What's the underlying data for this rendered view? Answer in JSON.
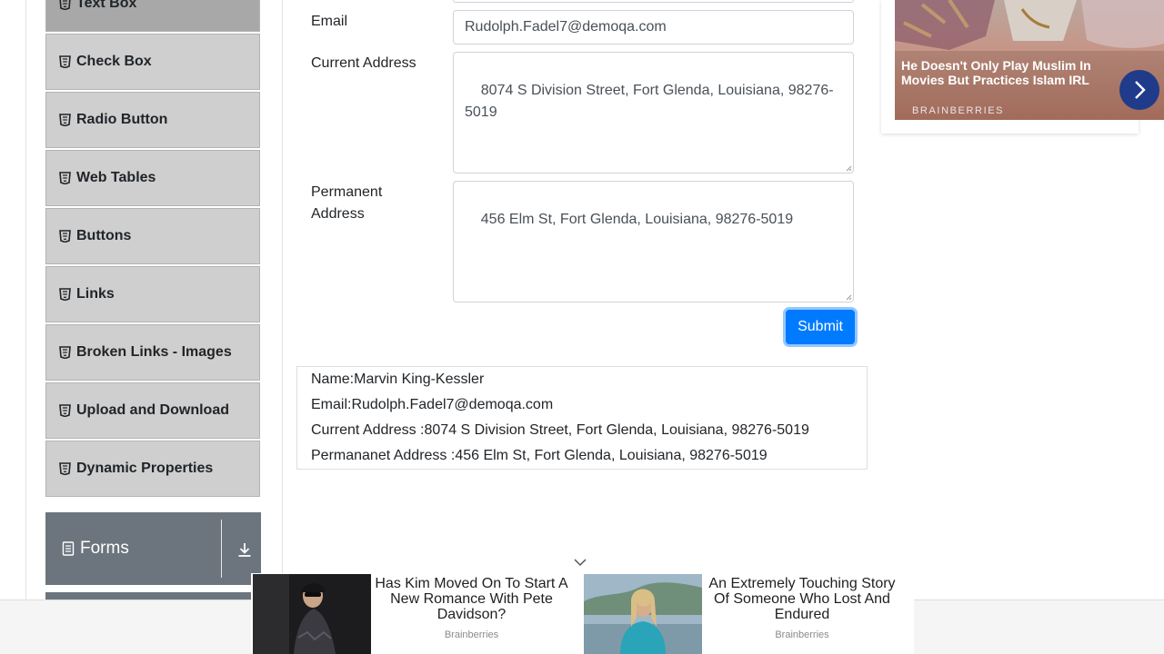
{
  "sidebar": {
    "items": [
      {
        "label": "Text Box",
        "icon": "html5-icon"
      },
      {
        "label": "Check Box",
        "icon": "html5-icon"
      },
      {
        "label": "Radio Button",
        "icon": "html5-icon"
      },
      {
        "label": "Web Tables",
        "icon": "html5-icon"
      },
      {
        "label": "Buttons",
        "icon": "html5-icon"
      },
      {
        "label": "Links",
        "icon": "html5-icon"
      },
      {
        "label": "Broken Links - Images",
        "icon": "html5-icon"
      },
      {
        "label": "Upload and Download",
        "icon": "html5-icon"
      },
      {
        "label": "Dynamic Properties",
        "icon": "html5-icon"
      }
    ],
    "group": {
      "label": "Forms",
      "icon": "document-icon",
      "toggle_icon": "download-arrow-icon"
    }
  },
  "form": {
    "email": {
      "label": "Email",
      "value": "Rudolph.Fadel7@demoqa.com"
    },
    "current_address": {
      "label": "Current Address",
      "value": "8074 S Division Street, Fort Glenda, Louisiana, 98276-5019"
    },
    "permanent_address": {
      "label": "Permanent Address",
      "value": "456 Elm St, Fort Glenda, Louisiana, 98276-5019"
    },
    "submit_label": "Submit"
  },
  "output": {
    "name": "Name:Marvin King-Kessler",
    "email": "Email:Rudolph.Fadel7@demoqa.com",
    "current_address": "Current Address :8074 S Division Street, Fort Glenda, Louisiana, 98276-5019",
    "permanent_address": "Permananet Address :456 Elm St, Fort Glenda, Louisiana, 98276-5019"
  },
  "side_ad": {
    "title": "He Doesn't Only Play Muslim In Movies But Practices Islam IRL",
    "brand": "BRAINBERRIES"
  },
  "bottom_ads": [
    {
      "title": "Has Kim Moved On To Start A New Romance With Pete Davidson?",
      "source": "Brainberries"
    },
    {
      "title": "An Extremely Touching Story Of Someone Who Lost And Endured",
      "source": "Brainberries"
    }
  ],
  "colors": {
    "primary": "#007bff",
    "sidebar_bg": "#cfcfcf",
    "group_bg": "#6c757d",
    "ad_arrow": "#1f3b89"
  }
}
